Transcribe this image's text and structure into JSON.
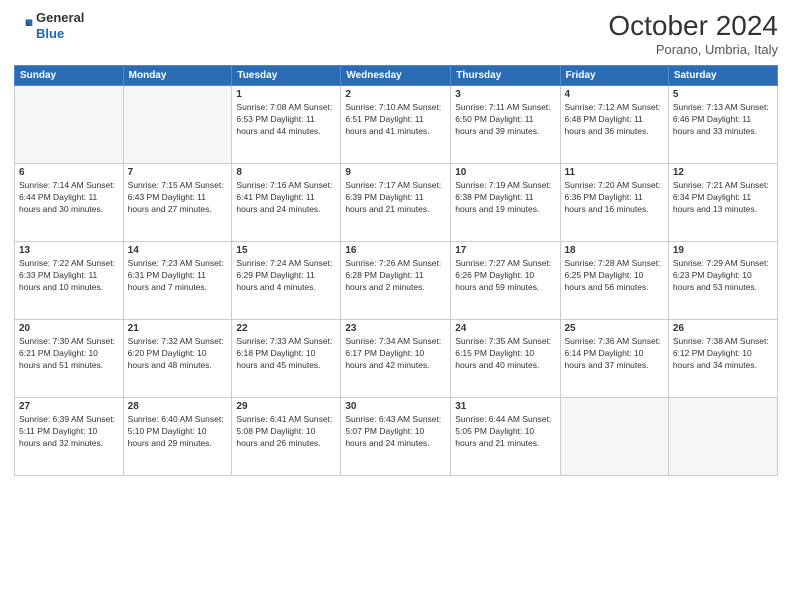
{
  "header": {
    "logo_line1": "General",
    "logo_line2": "Blue",
    "month": "October 2024",
    "location": "Porano, Umbria, Italy"
  },
  "weekdays": [
    "Sunday",
    "Monday",
    "Tuesday",
    "Wednesday",
    "Thursday",
    "Friday",
    "Saturday"
  ],
  "weeks": [
    [
      {
        "day": "",
        "info": ""
      },
      {
        "day": "",
        "info": ""
      },
      {
        "day": "1",
        "info": "Sunrise: 7:08 AM\nSunset: 6:53 PM\nDaylight: 11 hours\nand 44 minutes."
      },
      {
        "day": "2",
        "info": "Sunrise: 7:10 AM\nSunset: 6:51 PM\nDaylight: 11 hours\nand 41 minutes."
      },
      {
        "day": "3",
        "info": "Sunrise: 7:11 AM\nSunset: 6:50 PM\nDaylight: 11 hours\nand 39 minutes."
      },
      {
        "day": "4",
        "info": "Sunrise: 7:12 AM\nSunset: 6:48 PM\nDaylight: 11 hours\nand 36 minutes."
      },
      {
        "day": "5",
        "info": "Sunrise: 7:13 AM\nSunset: 6:46 PM\nDaylight: 11 hours\nand 33 minutes."
      }
    ],
    [
      {
        "day": "6",
        "info": "Sunrise: 7:14 AM\nSunset: 6:44 PM\nDaylight: 11 hours\nand 30 minutes."
      },
      {
        "day": "7",
        "info": "Sunrise: 7:15 AM\nSunset: 6:43 PM\nDaylight: 11 hours\nand 27 minutes."
      },
      {
        "day": "8",
        "info": "Sunrise: 7:16 AM\nSunset: 6:41 PM\nDaylight: 11 hours\nand 24 minutes."
      },
      {
        "day": "9",
        "info": "Sunrise: 7:17 AM\nSunset: 6:39 PM\nDaylight: 11 hours\nand 21 minutes."
      },
      {
        "day": "10",
        "info": "Sunrise: 7:19 AM\nSunset: 6:38 PM\nDaylight: 11 hours\nand 19 minutes."
      },
      {
        "day": "11",
        "info": "Sunrise: 7:20 AM\nSunset: 6:36 PM\nDaylight: 11 hours\nand 16 minutes."
      },
      {
        "day": "12",
        "info": "Sunrise: 7:21 AM\nSunset: 6:34 PM\nDaylight: 11 hours\nand 13 minutes."
      }
    ],
    [
      {
        "day": "13",
        "info": "Sunrise: 7:22 AM\nSunset: 6:33 PM\nDaylight: 11 hours\nand 10 minutes."
      },
      {
        "day": "14",
        "info": "Sunrise: 7:23 AM\nSunset: 6:31 PM\nDaylight: 11 hours\nand 7 minutes."
      },
      {
        "day": "15",
        "info": "Sunrise: 7:24 AM\nSunset: 6:29 PM\nDaylight: 11 hours\nand 4 minutes."
      },
      {
        "day": "16",
        "info": "Sunrise: 7:26 AM\nSunset: 6:28 PM\nDaylight: 11 hours\nand 2 minutes."
      },
      {
        "day": "17",
        "info": "Sunrise: 7:27 AM\nSunset: 6:26 PM\nDaylight: 10 hours\nand 59 minutes."
      },
      {
        "day": "18",
        "info": "Sunrise: 7:28 AM\nSunset: 6:25 PM\nDaylight: 10 hours\nand 56 minutes."
      },
      {
        "day": "19",
        "info": "Sunrise: 7:29 AM\nSunset: 6:23 PM\nDaylight: 10 hours\nand 53 minutes."
      }
    ],
    [
      {
        "day": "20",
        "info": "Sunrise: 7:30 AM\nSunset: 6:21 PM\nDaylight: 10 hours\nand 51 minutes."
      },
      {
        "day": "21",
        "info": "Sunrise: 7:32 AM\nSunset: 6:20 PM\nDaylight: 10 hours\nand 48 minutes."
      },
      {
        "day": "22",
        "info": "Sunrise: 7:33 AM\nSunset: 6:18 PM\nDaylight: 10 hours\nand 45 minutes."
      },
      {
        "day": "23",
        "info": "Sunrise: 7:34 AM\nSunset: 6:17 PM\nDaylight: 10 hours\nand 42 minutes."
      },
      {
        "day": "24",
        "info": "Sunrise: 7:35 AM\nSunset: 6:15 PM\nDaylight: 10 hours\nand 40 minutes."
      },
      {
        "day": "25",
        "info": "Sunrise: 7:36 AM\nSunset: 6:14 PM\nDaylight: 10 hours\nand 37 minutes."
      },
      {
        "day": "26",
        "info": "Sunrise: 7:38 AM\nSunset: 6:12 PM\nDaylight: 10 hours\nand 34 minutes."
      }
    ],
    [
      {
        "day": "27",
        "info": "Sunrise: 6:39 AM\nSunset: 5:11 PM\nDaylight: 10 hours\nand 32 minutes."
      },
      {
        "day": "28",
        "info": "Sunrise: 6:40 AM\nSunset: 5:10 PM\nDaylight: 10 hours\nand 29 minutes."
      },
      {
        "day": "29",
        "info": "Sunrise: 6:41 AM\nSunset: 5:08 PM\nDaylight: 10 hours\nand 26 minutes."
      },
      {
        "day": "30",
        "info": "Sunrise: 6:43 AM\nSunset: 5:07 PM\nDaylight: 10 hours\nand 24 minutes."
      },
      {
        "day": "31",
        "info": "Sunrise: 6:44 AM\nSunset: 5:05 PM\nDaylight: 10 hours\nand 21 minutes."
      },
      {
        "day": "",
        "info": ""
      },
      {
        "day": "",
        "info": ""
      }
    ]
  ]
}
